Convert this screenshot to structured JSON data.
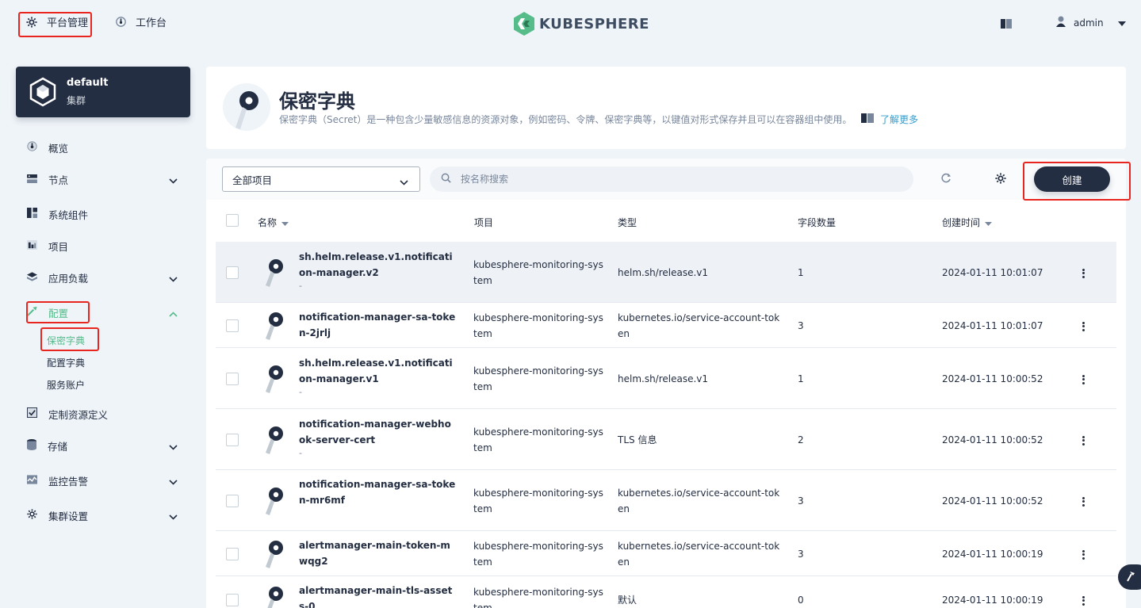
{
  "topbar": {
    "platform_label": "平台管理",
    "workbench_label": "工作台",
    "logo_text": "KUBESPHERE",
    "user_name": "admin"
  },
  "cluster": {
    "name": "default",
    "type": "集群"
  },
  "sidebar": {
    "items": [
      {
        "label": "概览",
        "icon": "dashboard-icon",
        "expandable": false
      },
      {
        "label": "节点",
        "icon": "nodes-icon",
        "expandable": true
      },
      {
        "label": "系统组件",
        "icon": "components-icon",
        "expandable": false
      },
      {
        "label": "项目",
        "icon": "project-icon",
        "expandable": false
      },
      {
        "label": "应用负载",
        "icon": "workload-icon",
        "expandable": true
      },
      {
        "label": "配置",
        "icon": "config-icon",
        "expandable": true,
        "expanded": true
      },
      {
        "label": "定制资源定义",
        "icon": "crd-icon",
        "expandable": false
      },
      {
        "label": "存储",
        "icon": "storage-icon",
        "expandable": true
      },
      {
        "label": "监控告警",
        "icon": "monitoring-icon",
        "expandable": true
      },
      {
        "label": "集群设置",
        "icon": "settings-icon",
        "expandable": true
      }
    ],
    "sub_items": [
      "保密字典",
      "配置字典",
      "服务账户"
    ],
    "active_sub": "保密字典"
  },
  "header": {
    "title": "保密字典",
    "description": "保密字典（Secret）是一种包含少量敏感信息的资源对象，例如密码、令牌、保密字典等，以键值对形式保存并且可以在容器组中使用。",
    "learn_more": "了解更多"
  },
  "toolbar": {
    "project_select": "全部项目",
    "search_placeholder": "按名称搜索",
    "create_label": "创建"
  },
  "table": {
    "columns": [
      "名称",
      "项目",
      "类型",
      "字段数量",
      "创建时间"
    ],
    "rows": [
      {
        "name": "sh.helm.release.v1.notification-manager.v2",
        "sub": "-",
        "project": "kubesphere-monitoring-system",
        "type": "helm.sh/release.v1",
        "fields": "1",
        "created": "2024-01-11 10:01:07"
      },
      {
        "name": "notification-manager-sa-token-2jrlj",
        "sub": "-",
        "project": "kubesphere-monitoring-system",
        "type": "kubernetes.io/service-account-token",
        "fields": "3",
        "created": "2024-01-11 10:01:07"
      },
      {
        "name": "sh.helm.release.v1.notification-manager.v1",
        "sub": "-",
        "project": "kubesphere-monitoring-system",
        "type": "helm.sh/release.v1",
        "fields": "1",
        "created": "2024-01-11 10:00:52"
      },
      {
        "name": "notification-manager-webhook-server-cert",
        "sub": "-",
        "project": "kubesphere-monitoring-system",
        "type": "TLS 信息",
        "fields": "2",
        "created": "2024-01-11 10:00:52"
      },
      {
        "name": "notification-manager-sa-token-mr6mf",
        "sub": "-",
        "project": "kubesphere-monitoring-system",
        "type": "kubernetes.io/service-account-token",
        "fields": "3",
        "created": "2024-01-11 10:00:52"
      },
      {
        "name": "alertmanager-main-token-mwqg2",
        "sub": "-",
        "project": "kubesphere-monitoring-system",
        "type": "kubernetes.io/service-account-token",
        "fields": "3",
        "created": "2024-01-11 10:00:19"
      },
      {
        "name": "alertmanager-main-tls-assets-0",
        "sub": "-",
        "project": "kubesphere-monitoring-system",
        "type": "默认",
        "fields": "0",
        "created": "2024-01-11 10:00:19"
      }
    ]
  },
  "colors": {
    "accent": "#55bc8a",
    "dark": "#242e42",
    "highlight_box": "#e8261f",
    "link": "#329dce"
  }
}
